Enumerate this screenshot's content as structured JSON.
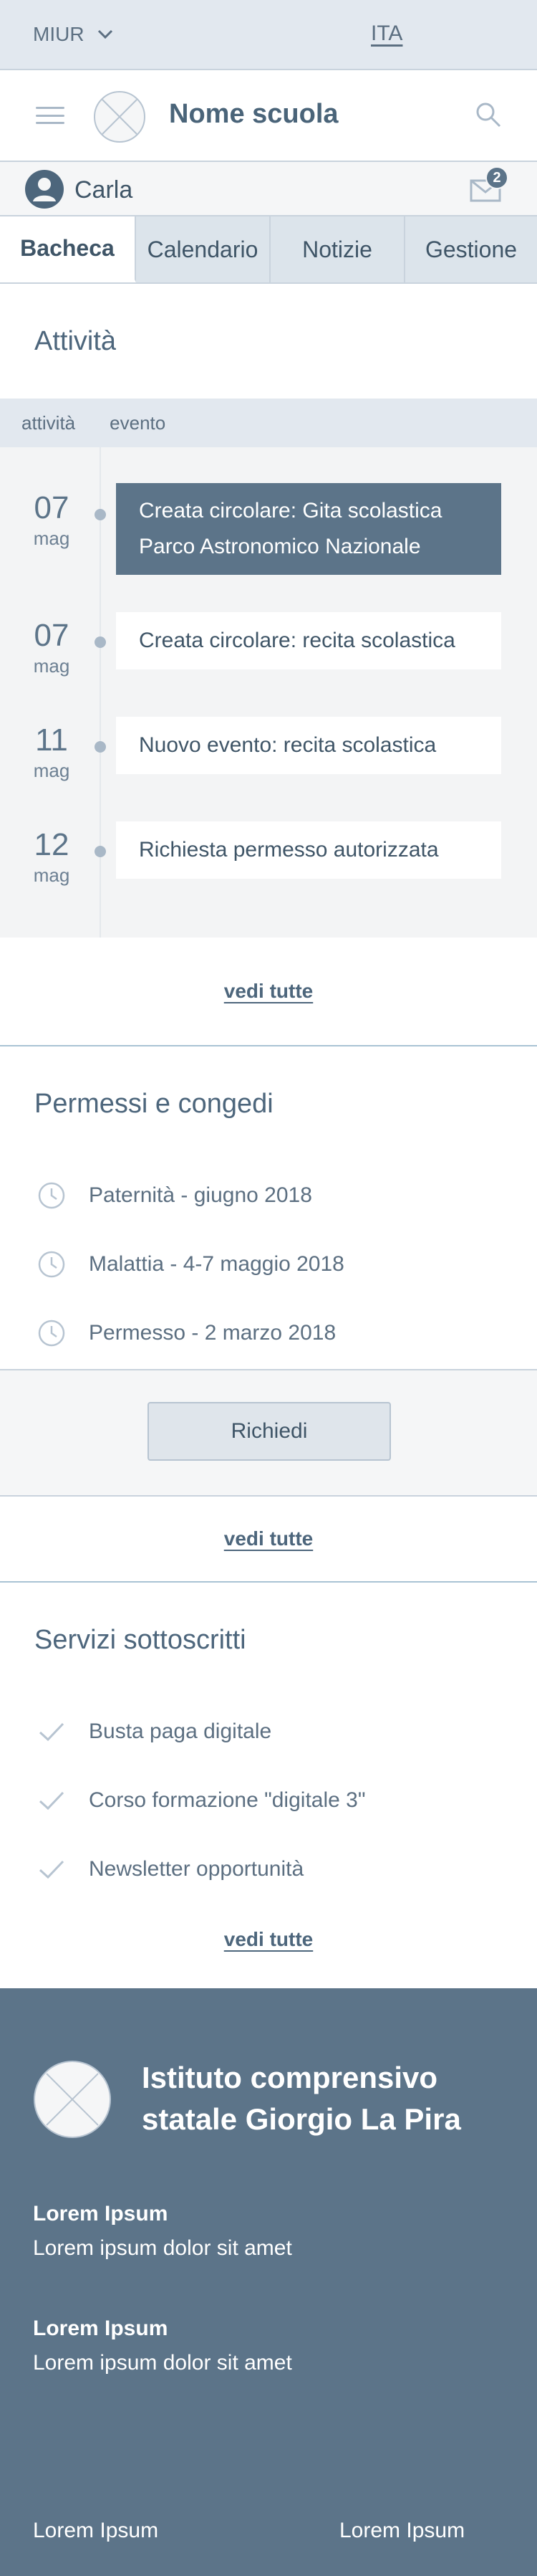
{
  "topbar": {
    "org_label": "MIUR",
    "language": "ITA"
  },
  "header": {
    "school_name": "Nome scuola"
  },
  "user": {
    "name": "Carla",
    "mail_count": "2"
  },
  "tabs": [
    {
      "label": "Bacheca",
      "active": true
    },
    {
      "label": "Calendario"
    },
    {
      "label": "Notizie"
    },
    {
      "label": "Gestione"
    }
  ],
  "activities": {
    "title": "Attività",
    "filters": [
      "attività",
      "evento"
    ],
    "events": [
      {
        "day": "07",
        "month": "mag",
        "text": "Creata circolare: Gita scolastica Parco Astronomico Nazionale",
        "highlight": true
      },
      {
        "day": "07",
        "month": "mag",
        "text": "Creata circolare: recita scolastica"
      },
      {
        "day": "11",
        "month": "mag",
        "text": "Nuovo evento: recita scolastica"
      },
      {
        "day": "12",
        "month": "mag",
        "text": "Richiesta permesso autorizzata"
      }
    ],
    "see_all": "vedi tutte"
  },
  "permissions": {
    "title": "Permessi e congedi",
    "items": [
      "Paternità - giugno 2018",
      "Malattia - 4-7 maggio 2018",
      "Permesso - 2 marzo 2018"
    ],
    "request_button": "Richiedi",
    "see_all": "vedi tutte"
  },
  "services": {
    "title": "Servizi sottoscritti",
    "items": [
      "Busta paga digitale",
      "Corso formazione \"digitale 3\"",
      "Newsletter opportunità"
    ],
    "see_all": "vedi tutte"
  },
  "footer": {
    "institute_name": "Istituto comprensivo statale Giorgio La Pira",
    "blocks": [
      {
        "title": "Lorem Ipsum",
        "text": "Lorem ipsum dolor sit amet"
      },
      {
        "title": "Lorem Ipsum",
        "text": "Lorem ipsum dolor sit amet"
      }
    ],
    "links": [
      "Lorem Ipsum",
      "Lorem Ipsum"
    ]
  },
  "colors": {
    "accent": "#5c7489",
    "topbar_bg": "#e2e8ef",
    "text": "#3f5567"
  },
  "icons": [
    "chevron-down-icon",
    "hamburger-menu-icon",
    "logo-placeholder-icon",
    "search-icon",
    "user-avatar-icon",
    "mail-icon",
    "clock-icon",
    "check-icon"
  ]
}
